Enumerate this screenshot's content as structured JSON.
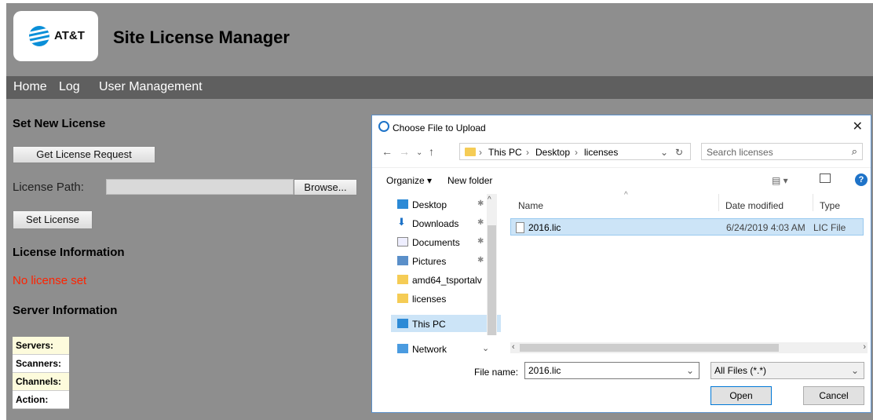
{
  "header": {
    "logo_text": "AT&T",
    "title": "Site License Manager"
  },
  "nav": {
    "items": [
      "Home",
      "Log",
      "User Management"
    ]
  },
  "left": {
    "set_new_license_title": "Set New License",
    "get_license_button": "Get License Request",
    "license_path_label": "License Path:",
    "browse_button": "Browse...",
    "set_license_button": "Set License",
    "license_info_title": "License Information",
    "no_license_text": "No license set",
    "server_info_title": "Server Information",
    "server_rows": [
      "Servers:",
      "Scanners:",
      "Channels:",
      "Action:"
    ]
  },
  "dialog": {
    "title": "Choose File to Upload",
    "close": "✕",
    "breadcrumb": [
      "This PC",
      "Desktop",
      "licenses"
    ],
    "search_placeholder": "Search licenses",
    "organize": "Organize ▾",
    "new_folder": "New folder",
    "tree": [
      {
        "label": "Desktop",
        "pinned": true
      },
      {
        "label": "Downloads",
        "pinned": true
      },
      {
        "label": "Documents",
        "pinned": true
      },
      {
        "label": "Pictures",
        "pinned": true
      },
      {
        "label": "amd64_tsportalv",
        "pinned": false
      },
      {
        "label": "licenses",
        "pinned": false
      },
      {
        "label": "This PC",
        "pinned": false
      },
      {
        "label": "Network",
        "pinned": false
      }
    ],
    "columns": [
      "Name",
      "Date modified",
      "Type"
    ],
    "files": [
      {
        "name": "2016.lic",
        "date": "6/24/2019 4:03 AM",
        "type": "LIC File"
      }
    ],
    "file_name_label": "File name:",
    "file_name_value": "2016.lic",
    "filter": "All Files (*.*)",
    "open_button": "Open",
    "cancel_button": "Cancel"
  },
  "colors": {
    "page_bg": "#8e8e8e",
    "nav_bg": "#5f5f5f",
    "error": "#ff2200",
    "accent": "#0078d7"
  }
}
